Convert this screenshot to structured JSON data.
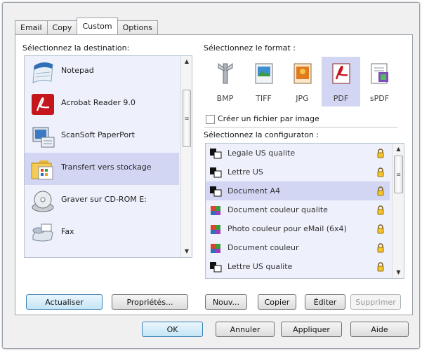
{
  "tabs": [
    "Email",
    "Copy",
    "Custom",
    "Options"
  ],
  "active_tab": "Custom",
  "destination": {
    "label": "Sélectionnez la destination:",
    "items": [
      {
        "label": "Notepad",
        "icon": "notepad-icon"
      },
      {
        "label": "Acrobat Reader 9.0",
        "icon": "acrobat-icon"
      },
      {
        "label": "ScanSoft PaperPort",
        "icon": "paperport-icon"
      },
      {
        "label": "Transfert vers stockage",
        "icon": "folder-transfer-icon"
      },
      {
        "label": "Graver sur CD-ROM  E:",
        "icon": "cd-rom-icon"
      },
      {
        "label": "Fax",
        "icon": "fax-icon"
      }
    ],
    "selected": "Transfert vers stockage",
    "refresh_button": "Actualiser",
    "properties_button": "Propriétés..."
  },
  "format": {
    "label": "Sélectionnez le format :",
    "items": [
      "BMP",
      "TIFF",
      "JPG",
      "PDF",
      "sPDF"
    ],
    "selected": "PDF",
    "checkbox_label": "Créer un fichier par image",
    "checkbox_checked": false
  },
  "configuration": {
    "label": "Sélectionnez la configuraton :",
    "items": [
      {
        "label": "Legale US qualite",
        "icon": "bw-doc-icon"
      },
      {
        "label": "Lettre US",
        "icon": "bw-doc-icon"
      },
      {
        "label": "Document A4",
        "icon": "bw-doc-icon"
      },
      {
        "label": "Document couleur qualite",
        "icon": "color-doc-icon"
      },
      {
        "label": "Photo couleur pour eMail (6x4)",
        "icon": "color-doc-icon"
      },
      {
        "label": "Document couleur",
        "icon": "color-doc-icon"
      },
      {
        "label": "Lettre US qualite",
        "icon": "bw-doc-icon"
      }
    ],
    "selected": "Document A4",
    "new_button": "Nouv...",
    "copy_button": "Copier",
    "edit_button": "Éditer",
    "delete_button": "Supprimer"
  },
  "footer": {
    "ok": "OK",
    "cancel": "Annuler",
    "apply": "Appliquer",
    "help": "Aide"
  },
  "colors": {
    "selection": "#d2d6f3",
    "list_background": "#eef0fb",
    "accent": "#3c7fb1"
  }
}
